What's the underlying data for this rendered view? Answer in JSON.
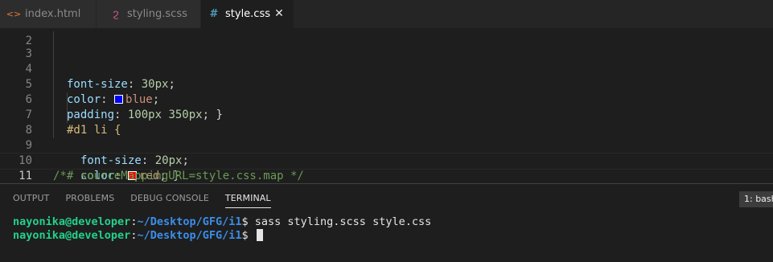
{
  "tabs": [
    {
      "label": "index.html",
      "icon": "html-icon",
      "icon_glyph": "<>",
      "icon_color": "#e37933",
      "active": false
    },
    {
      "label": "styling.scss",
      "icon": "sass-icon",
      "icon_glyph": "ϩ",
      "icon_color": "#c6538c",
      "active": false
    },
    {
      "label": "style.css",
      "icon": "css-icon",
      "icon_glyph": "#",
      "icon_color": "#519aba",
      "active": true,
      "close_glyph": "✕"
    }
  ],
  "editor": {
    "lines": [
      {
        "number": "2"
      },
      {
        "number": "3",
        "prop": "font-size",
        "value": "30px"
      },
      {
        "number": "4",
        "prop": "color",
        "value": "blue",
        "swatch": "#0000ff"
      },
      {
        "number": "5",
        "prop": "padding",
        "value": "100px 350px",
        "close": "}"
      },
      {
        "number": "6",
        "selector": "#d1 li {"
      },
      {
        "number": "7",
        "prop": "font-size",
        "value": "20px"
      },
      {
        "number": "8",
        "prop": "color",
        "value": "red",
        "swatch": "#ff0000",
        "close": "}"
      },
      {
        "number": "9"
      },
      {
        "number": "10",
        "comment": "/*# sourceMappingURL=style.css.map */"
      },
      {
        "number": "11"
      }
    ]
  },
  "panel": {
    "tabs": [
      "OUTPUT",
      "PROBLEMS",
      "DEBUG CONSOLE",
      "TERMINAL"
    ],
    "active_tab": "TERMINAL",
    "terminal_select": "1: bash"
  },
  "terminal": {
    "lines": [
      {
        "user": "nayonika@developer",
        "sep": ":",
        "path": "~/Desktop/GFG/i1",
        "prompt": "$ ",
        "command": "sass styling.scss style.css"
      },
      {
        "user": "nayonika@developer",
        "sep": ":",
        "path": "~/Desktop/GFG/i1",
        "prompt": "$ ",
        "command": ""
      }
    ]
  },
  "colors": {
    "editor_bg": "#1e1e1e",
    "tabbar_bg": "#252526",
    "property": "#9cdcfe",
    "number": "#b5cea8",
    "string_value": "#ce9178",
    "selector": "#d7ba7d",
    "comment": "#6a9955",
    "terminal_user": "#23d18b",
    "terminal_path": "#3b8eea"
  }
}
